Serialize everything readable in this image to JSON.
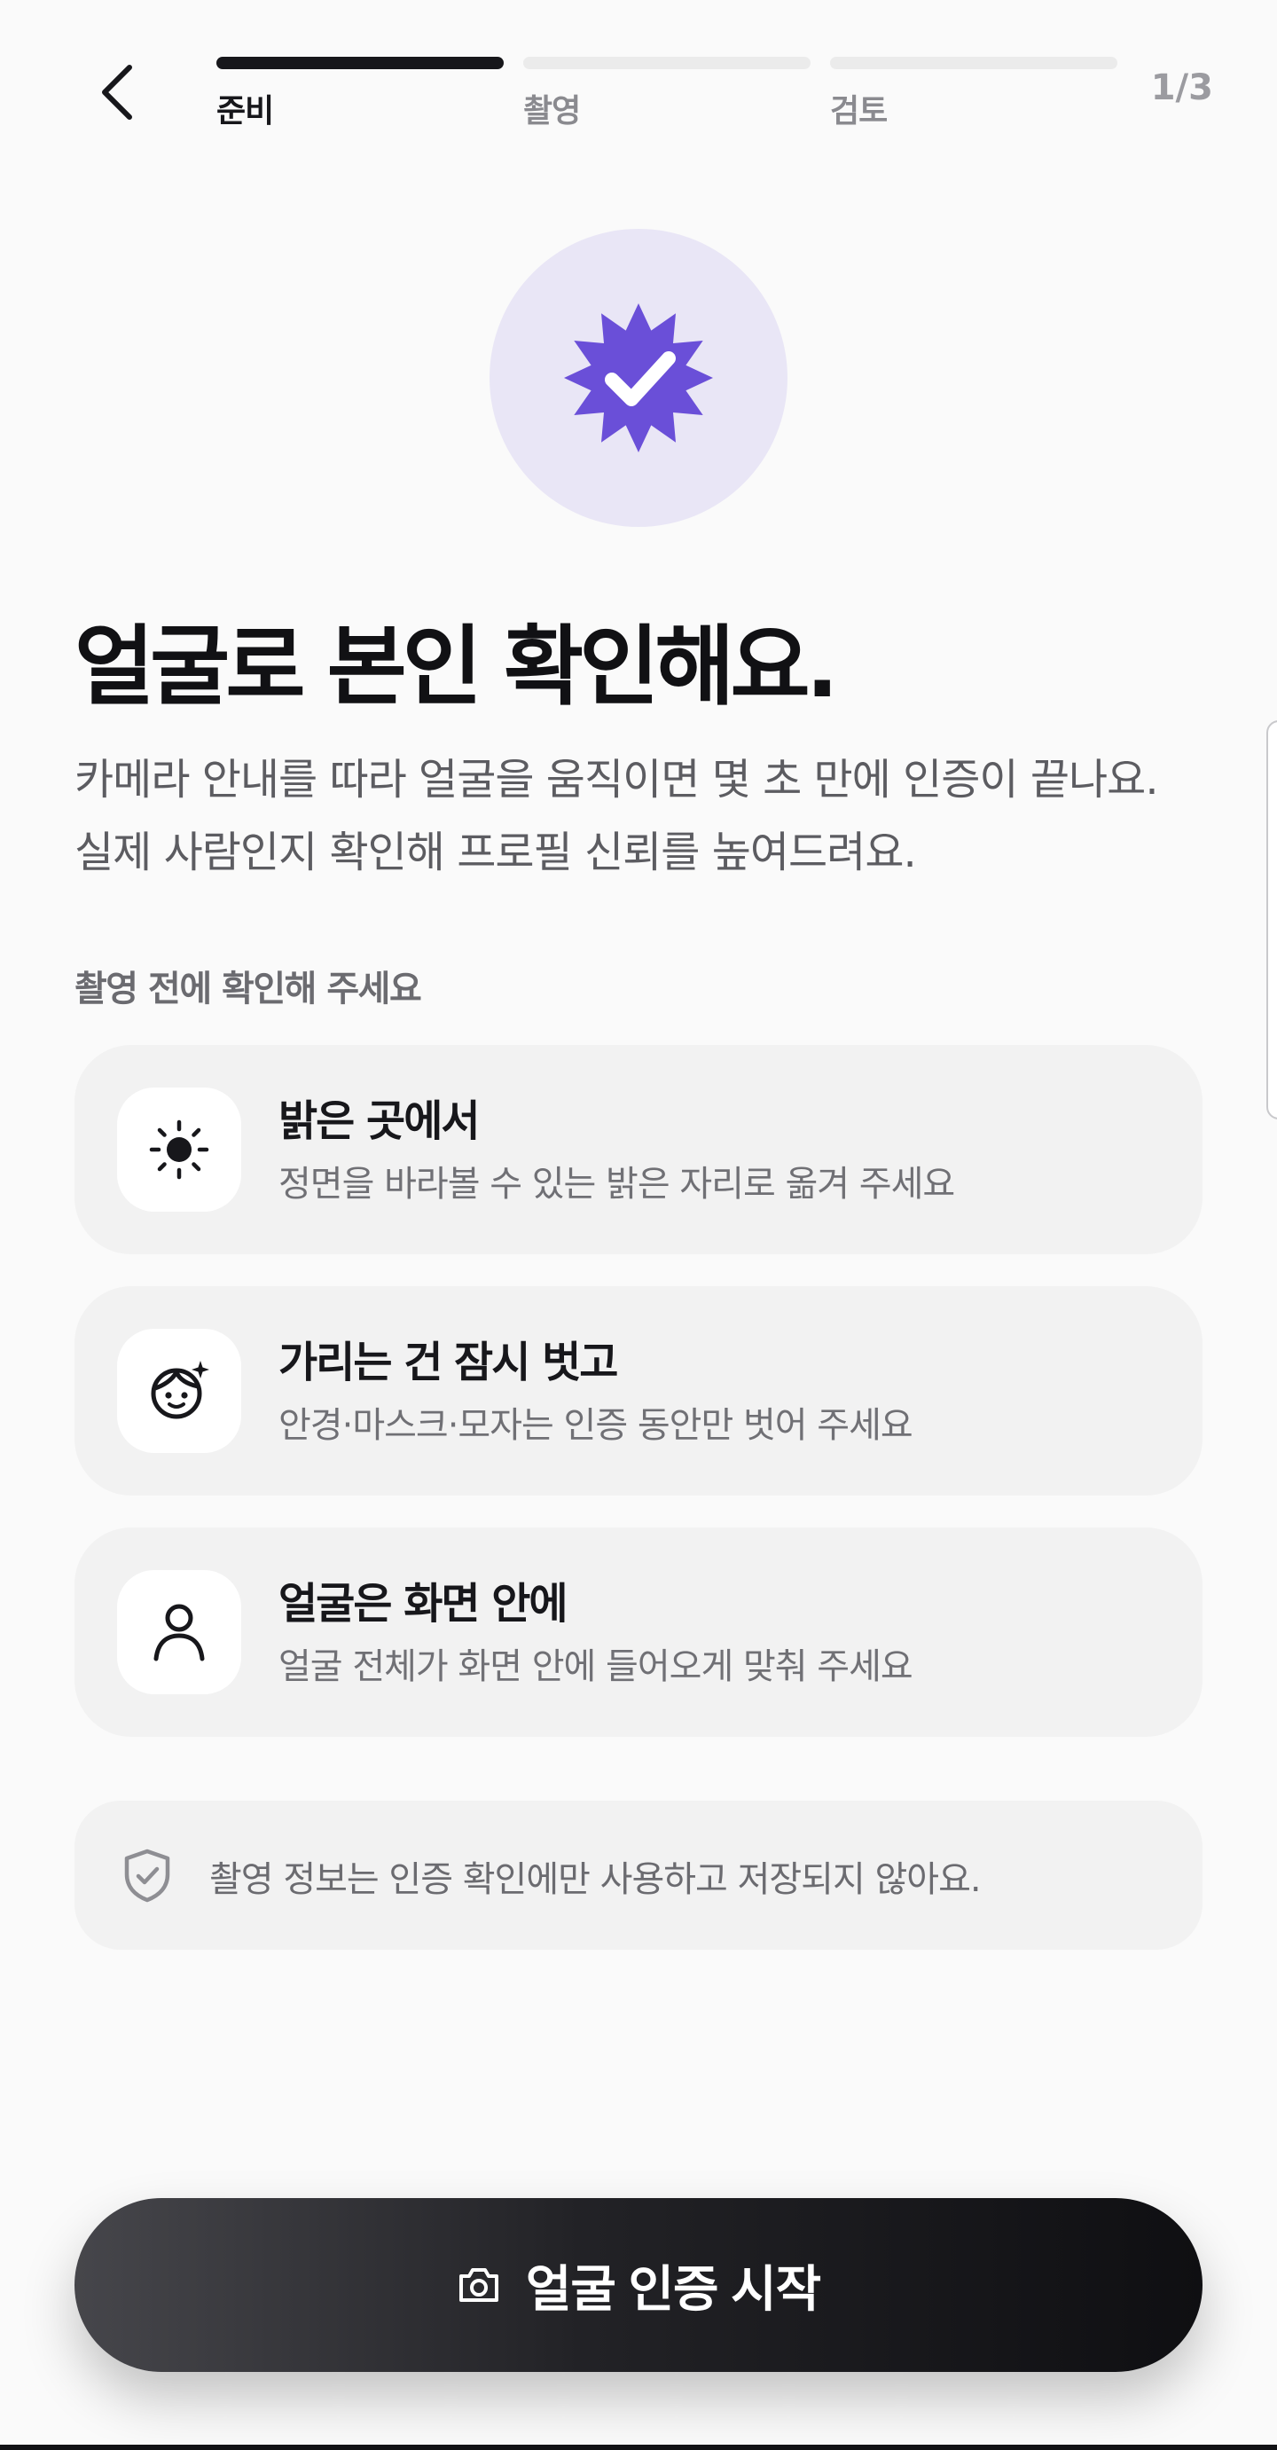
{
  "header": {
    "back_icon": "chevron-left-icon",
    "steps": [
      {
        "label": "준비",
        "active": true
      },
      {
        "label": "촬영",
        "active": false
      },
      {
        "label": "검토",
        "active": false
      }
    ],
    "step_counter": "1/3"
  },
  "hero": {
    "icon": "verified-badge-icon",
    "badge_color": "#6a4fd8",
    "circle_color": "#e9e6f6"
  },
  "title": "얼굴로 본인 확인해요.",
  "description": "카메라 안내를 따라 얼굴을 움직이면 몇 초 만에 인증이 끝나요. 실제 사람인지 확인해 프로필 신뢰를 높여드려요.",
  "checklist": {
    "label": "촬영 전에 확인해 주세요",
    "items": [
      {
        "icon": "sun-icon",
        "title": "밝은 곳에서",
        "subtitle": "정면을 바라볼 수 있는 밝은 자리로 옮겨 주세요"
      },
      {
        "icon": "face-sparkle-icon",
        "title": "가리는 건 잠시 벗고",
        "subtitle": "안경·마스크·모자는 인증 동안만 벗어 주세요"
      },
      {
        "icon": "person-icon",
        "title": "얼굴은 화면 안에",
        "subtitle": "얼굴 전체가 화면 안에 들어오게 맞춰 주세요"
      }
    ]
  },
  "notice": {
    "icon": "shield-check-icon",
    "text": "촬영 정보는 인증 확인에만 사용하고 저장되지 않아요."
  },
  "cta": {
    "icon": "camera-icon",
    "label": "얼굴 인증 시작"
  }
}
